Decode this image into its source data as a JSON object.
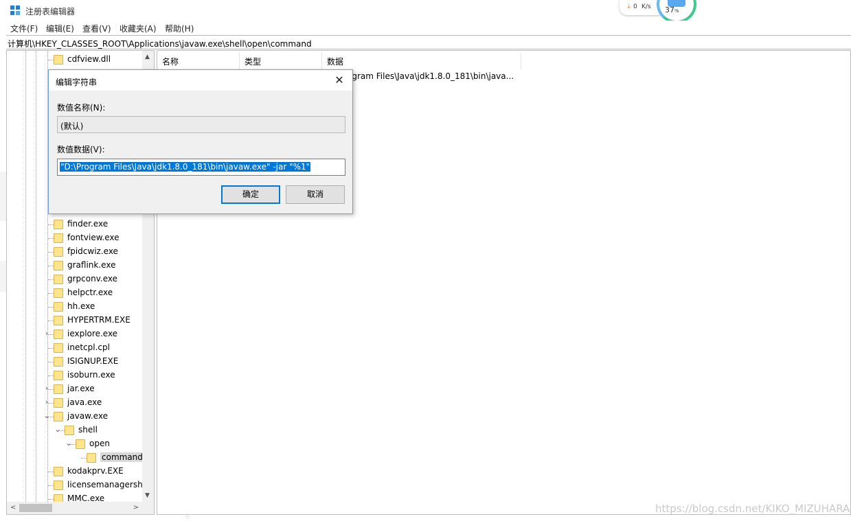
{
  "window": {
    "title": "注册表编辑器"
  },
  "menu": [
    "文件(F)",
    "编辑(E)",
    "查看(V)",
    "收藏夹(A)",
    "帮助(H)"
  ],
  "address": "计算机\\HKEY_CLASSES_ROOT\\Applications\\javaw.exe\\shell\\open\\command",
  "network_widget": {
    "speed": "0",
    "unit": "K/s",
    "percent": "37",
    "percent_sign": "%"
  },
  "tree": [
    {
      "label": "cdfview.dll",
      "level": 0,
      "expander": ""
    },
    {
      "label": "finder.exe",
      "level": 0,
      "expander": ""
    },
    {
      "label": "fontview.exe",
      "level": 0,
      "expander": ""
    },
    {
      "label": "fpidcwiz.exe",
      "level": 0,
      "expander": ""
    },
    {
      "label": "graflink.exe",
      "level": 0,
      "expander": ""
    },
    {
      "label": "grpconv.exe",
      "level": 0,
      "expander": ""
    },
    {
      "label": "helpctr.exe",
      "level": 0,
      "expander": ""
    },
    {
      "label": "hh.exe",
      "level": 0,
      "expander": ""
    },
    {
      "label": "HYPERTRM.EXE",
      "level": 0,
      "expander": ""
    },
    {
      "label": "iexplore.exe",
      "level": 0,
      "expander": ">"
    },
    {
      "label": "inetcpl.cpl",
      "level": 0,
      "expander": ""
    },
    {
      "label": "ISIGNUP.EXE",
      "level": 0,
      "expander": ""
    },
    {
      "label": "isoburn.exe",
      "level": 0,
      "expander": ""
    },
    {
      "label": "jar.exe",
      "level": 0,
      "expander": ">"
    },
    {
      "label": "java.exe",
      "level": 0,
      "expander": ">"
    },
    {
      "label": "javaw.exe",
      "level": 0,
      "expander": "v"
    },
    {
      "label": "shell",
      "level": 1,
      "expander": "v"
    },
    {
      "label": "open",
      "level": 2,
      "expander": "v"
    },
    {
      "label": "command",
      "level": 3,
      "expander": "",
      "selected": true
    },
    {
      "label": "kodakprv.EXE",
      "level": 0,
      "expander": ""
    },
    {
      "label": "licensemanagershe",
      "level": 0,
      "expander": ""
    },
    {
      "label": "MMC.exe",
      "level": 0,
      "expander": ""
    }
  ],
  "list": {
    "columns": [
      "名称",
      "类型",
      "数据"
    ],
    "value_data": "ogram Files\\Java\\jdk1.8.0_181\\bin\\java..."
  },
  "dialog": {
    "title": "编辑字符串",
    "name_label": "数值名称(N):",
    "name_value": "(默认)",
    "data_label": "数值数据(V):",
    "data_value": "\"D:\\Program Files\\Java\\jdk1.8.0_181\\bin\\javaw.exe\" -jar \"%1\"",
    "ok": "确定",
    "cancel": "取消",
    "close": "✕"
  },
  "watermark": "https://blog.csdn.net/KIKO_MIZUHARA",
  "colors": {
    "selection": "#0078d7",
    "folder": "#fde58d",
    "accent_border": "#6d9fd5"
  }
}
